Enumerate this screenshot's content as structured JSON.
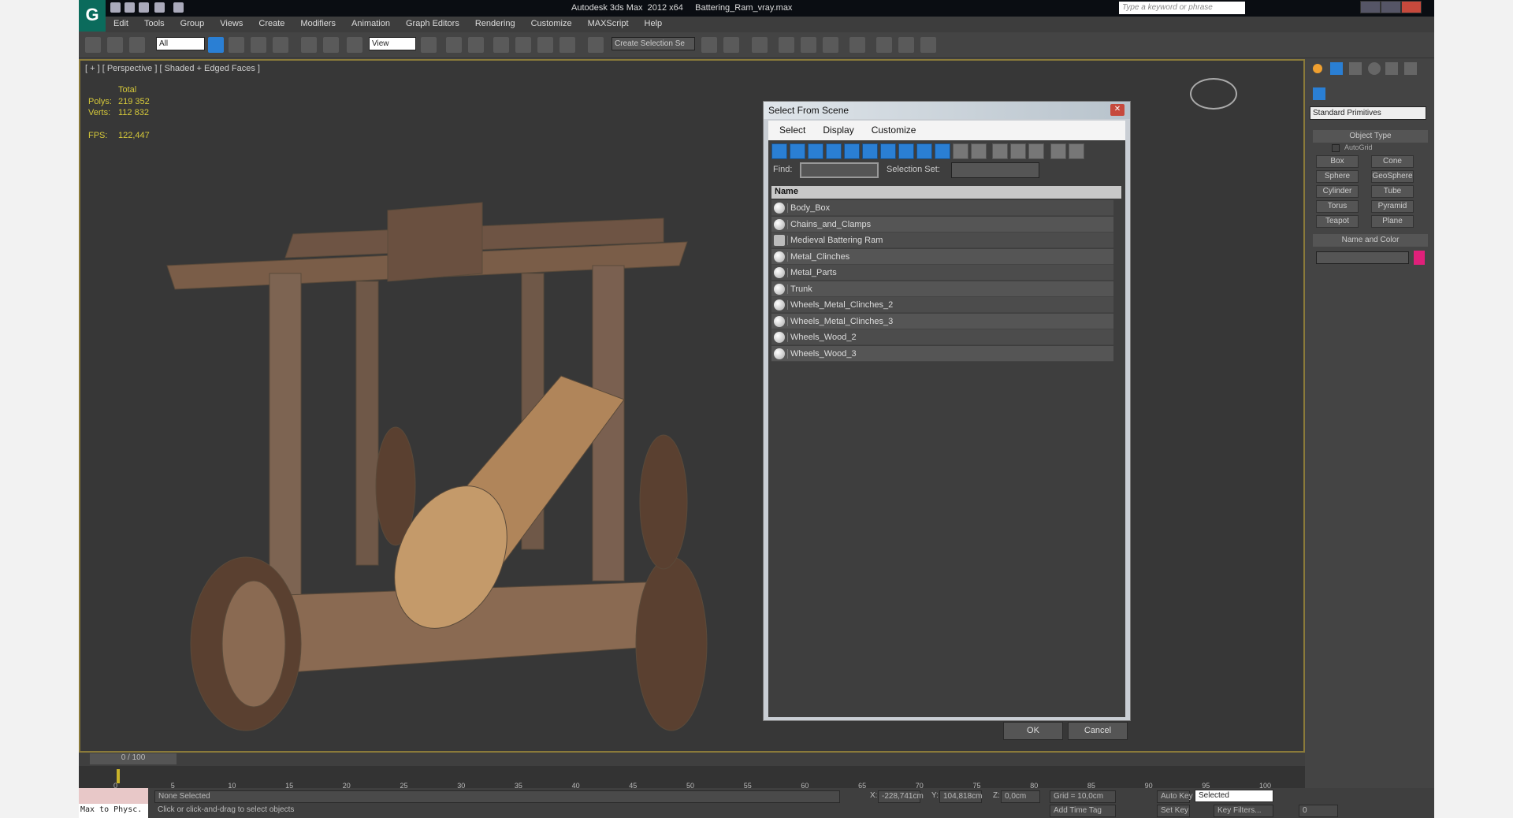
{
  "app": {
    "title": "Autodesk 3ds Max  2012 x64     Battering_Ram_vray.max",
    "search_placeholder": "Type a keyword or phrase"
  },
  "menu": [
    "Edit",
    "Tools",
    "Group",
    "Views",
    "Create",
    "Modifiers",
    "Animation",
    "Graph Editors",
    "Rendering",
    "Customize",
    "MAXScript",
    "Help"
  ],
  "toolbar": {
    "filter": "All",
    "ref_coord": "View",
    "selection_set": "Create Selection Se"
  },
  "viewport": {
    "label": "[ + ] [ Perspective ] [ Shaded + Edged Faces ]",
    "total": "Total",
    "polys_label": "Polys:",
    "polys": "219 352",
    "verts_label": "Verts:",
    "verts": "112 832",
    "fps_label": "FPS:",
    "fps": "122,447"
  },
  "command_panel": {
    "category": "Standard Primitives",
    "object_type": "Object Type",
    "autogrid": "AutoGrid",
    "buttons": [
      "Box",
      "Cone",
      "Sphere",
      "GeoSphere",
      "Cylinder",
      "Tube",
      "Torus",
      "Pyramid",
      "Teapot",
      "Plane"
    ],
    "name_color": "Name and Color",
    "color": "#e0207a"
  },
  "dialog": {
    "title": "Select From Scene",
    "menu": [
      "Select",
      "Display",
      "Customize"
    ],
    "find_label": "Find:",
    "selset_label": "Selection Set:",
    "column": "Name",
    "items": [
      "Body_Box",
      "Chains_and_Clamps",
      "Medieval Battering Ram",
      "Metal_Clinches",
      "Metal_Parts",
      "Trunk",
      "Wheels_Metal_Clinches_2",
      "Wheels_Metal_Clinches_3",
      "Wheels_Wood_2",
      "Wheels_Wood_3"
    ],
    "ok": "OK",
    "cancel": "Cancel"
  },
  "timeline": {
    "frame": "0 / 100",
    "ticks": [
      "0",
      "5",
      "10",
      "15",
      "20",
      "25",
      "30",
      "35",
      "40",
      "45",
      "50",
      "55",
      "60",
      "65",
      "70",
      "75",
      "80",
      "85",
      "90",
      "95",
      "100"
    ]
  },
  "status": {
    "script": "Max to Physc.",
    "selected": "None Selected",
    "prompt": "Click or click-and-drag to select objects",
    "x_label": "X:",
    "x": "-228,741cm",
    "y_label": "Y:",
    "y": "104,818cm",
    "z_label": "Z:",
    "z": "0,0cm",
    "grid": "Grid = 10,0cm",
    "add_time_tag": "Add Time Tag",
    "auto_key": "Auto Key",
    "key_mode": "Selected",
    "set_key": "Set Key",
    "key_filters": "Key Filters...",
    "current_frame": "0"
  }
}
